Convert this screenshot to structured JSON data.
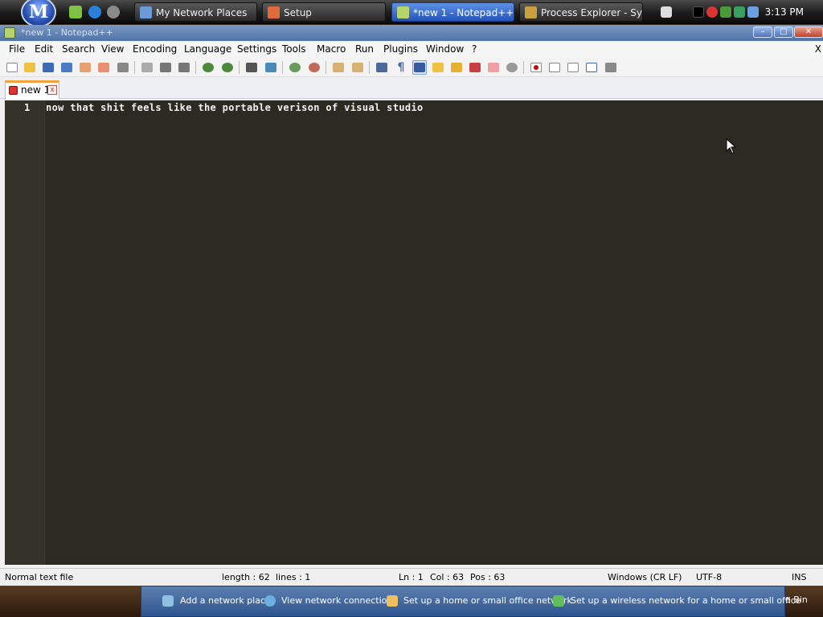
{
  "taskbar": {
    "start_label": "M",
    "buttons": [
      {
        "label": "My Network Places"
      },
      {
        "label": "Setup"
      },
      {
        "label": "*new 1 - Notepad++"
      },
      {
        "label": "Process Explorer - Sys..."
      }
    ],
    "clock": "3:13 PM"
  },
  "window": {
    "title": "*new 1 - Notepad++",
    "controls": {
      "minimize": "–",
      "maximize": "□",
      "close": "✕"
    }
  },
  "menu": {
    "items": [
      "File",
      "Edit",
      "Search",
      "View",
      "Encoding",
      "Language",
      "Settings",
      "Tools",
      "Macro",
      "Run",
      "Plugins",
      "Window",
      "?"
    ],
    "doc_close": "X"
  },
  "toolbar": {
    "icons": [
      "new-file-icon",
      "open-file-icon",
      "save-icon",
      "save-all-icon",
      "close-icon",
      "close-all-icon",
      "print-icon",
      "cut-icon",
      "copy-icon",
      "paste-icon",
      "undo-icon",
      "redo-icon",
      "find-icon",
      "replace-icon",
      "zoom-in-icon",
      "zoom-out-icon",
      "sync-vertical-icon",
      "sync-horizontal-icon",
      "word-wrap-icon",
      "show-all-chars-icon",
      "indent-guide-icon",
      "folder-icon",
      "doc-map-icon",
      "function-list-icon",
      "folder-workspace-icon",
      "monitor-icon",
      "record-macro-icon",
      "stop-macro-icon",
      "play-macro-icon",
      "run-macro-multiple-icon",
      "save-macro-icon"
    ]
  },
  "tabs": [
    {
      "label": "new 1",
      "close": "x"
    }
  ],
  "editor": {
    "line_number": "1",
    "line_text": "now that shit feels like the portable verison of visual studio"
  },
  "statusbar": {
    "file_type": "Normal text file",
    "length": "length : 62",
    "lines": "lines : 1",
    "ln": "Ln : 1",
    "col": "Col : 63",
    "pos": "Pos : 63",
    "eol": "Windows (CR LF)",
    "encoding": "UTF-8",
    "mode": "INS"
  },
  "network_tasks": {
    "items": [
      "Add a network place",
      "View network connections",
      "Set up a home or small office network",
      "Set up a wireless network for a home or small office"
    ],
    "recycle_bin_partial": "e Bin"
  }
}
